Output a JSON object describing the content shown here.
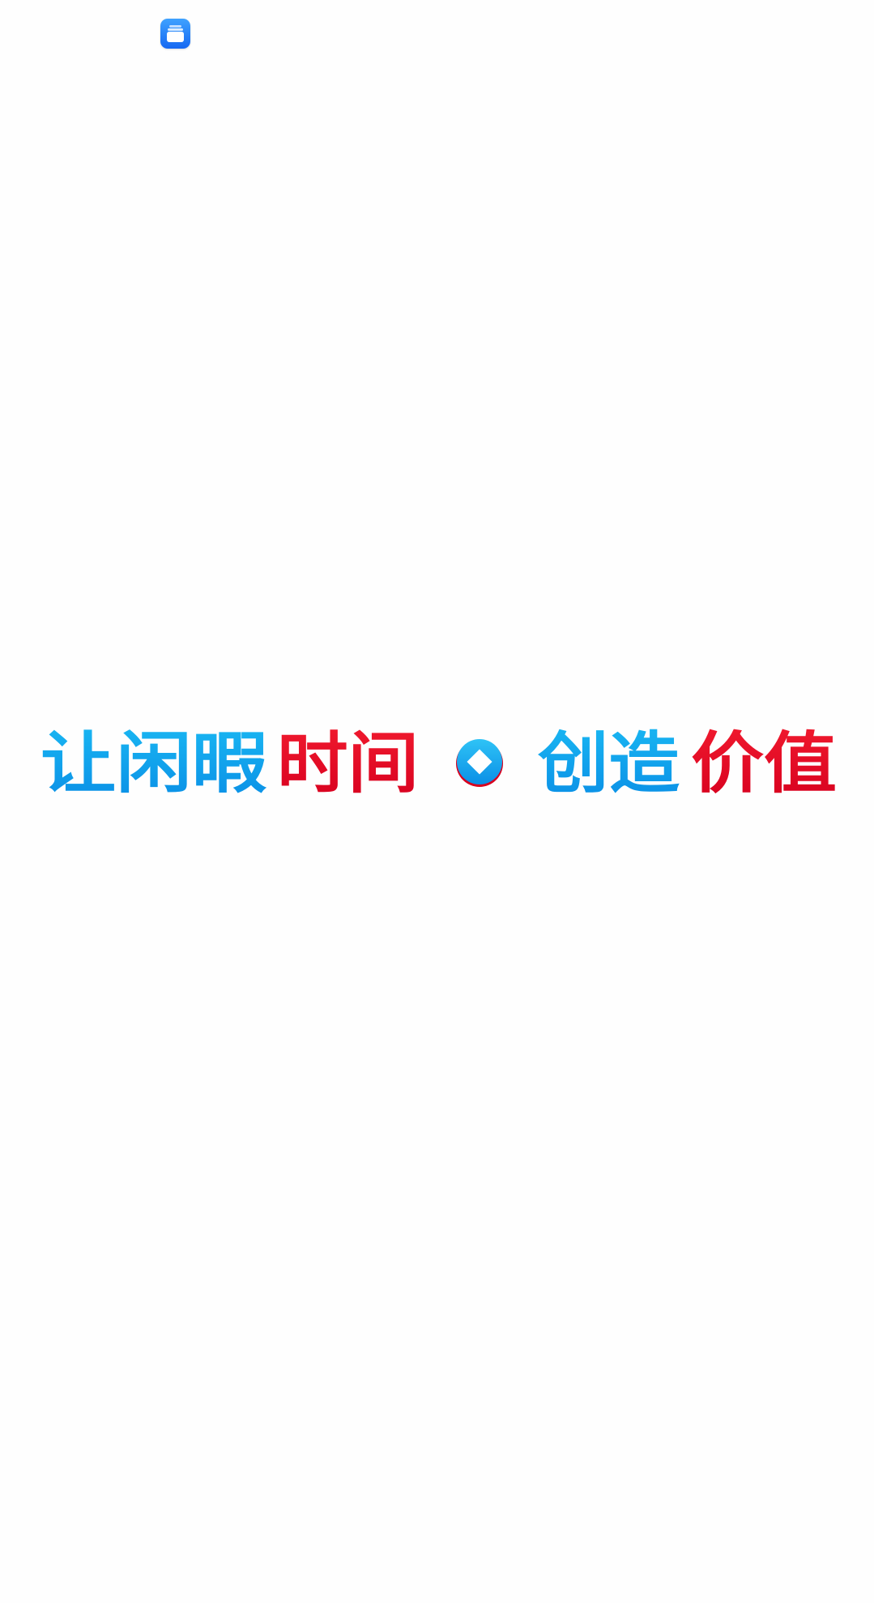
{
  "status_bar": {
    "app_icon": "stacked-cards-app-icon"
  },
  "splash": {
    "slogan_segments": [
      {
        "text": "让闲暇",
        "color": "blue"
      },
      {
        "text": "时间",
        "color": "red"
      },
      {
        "text": "创造",
        "color": "blue"
      },
      {
        "text": "价值",
        "color": "red"
      }
    ],
    "separator_icon": "diamond-badge-icon",
    "colors": {
      "blue_top": "#19b6f2",
      "blue_bottom": "#0a8fe6",
      "red_top": "#f01a2e",
      "red_bottom": "#d7001f",
      "app_icon_top": "#3fa2ff",
      "app_icon_bottom": "#1668f2"
    }
  }
}
